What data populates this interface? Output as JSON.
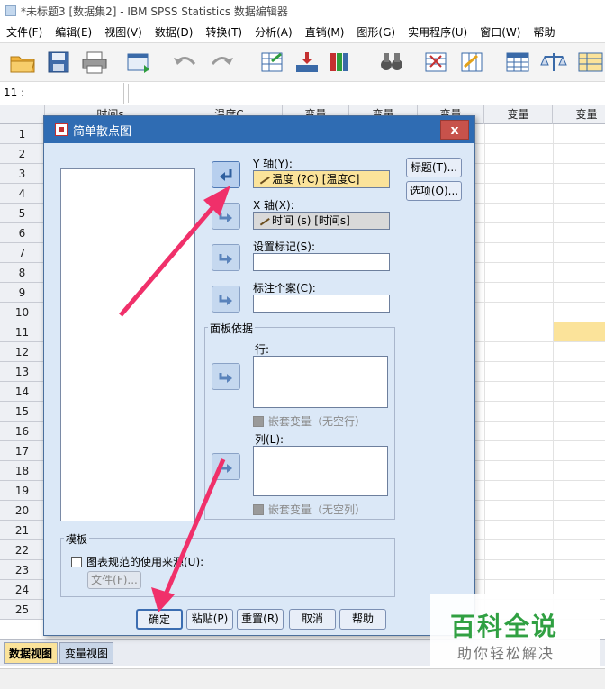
{
  "window": {
    "title": "*未标题3 [数据集2] - IBM SPSS Statistics 数据编辑器"
  },
  "menubar": {
    "items": [
      {
        "label": "文件(F)"
      },
      {
        "label": "编辑(E)"
      },
      {
        "label": "视图(V)"
      },
      {
        "label": "数据(D)"
      },
      {
        "label": "转换(T)"
      },
      {
        "label": "分析(A)"
      },
      {
        "label": "直销(M)"
      },
      {
        "label": "图形(G)"
      },
      {
        "label": "实用程序(U)"
      },
      {
        "label": "窗口(W)"
      },
      {
        "label": "帮助"
      }
    ]
  },
  "toolbar": {
    "icons": [
      "open-folder-icon",
      "save-icon",
      "print-icon",
      "dialog-recall-icon",
      "undo-icon",
      "redo-icon",
      "goto-case-icon",
      "goto-variable-icon",
      "variables-icon",
      "find-icon",
      "insert-cases-icon",
      "insert-variable-icon",
      "split-file-icon",
      "weight-cases-icon",
      "select-cases-icon"
    ],
    "colors": {
      "accent": "#3a6aa8"
    }
  },
  "refbar": {
    "cell_ref": "11 :"
  },
  "grid": {
    "columns": [
      "时间s",
      "温度C",
      "变量",
      "变量",
      "变量",
      "变量",
      "变量"
    ],
    "rows": [
      "1",
      "2",
      "3",
      "4",
      "5",
      "6",
      "7",
      "8",
      "9",
      "10",
      "11",
      "12",
      "13",
      "14",
      "15",
      "16",
      "17",
      "18",
      "19",
      "20",
      "21",
      "22",
      "23",
      "24",
      "25"
    ],
    "highlight_color": "#fbe39a"
  },
  "tabs": {
    "data_view": "数据视图",
    "variable_view": "变量视图"
  },
  "dialog": {
    "title": "简单散点图",
    "close": "x",
    "y_axis": {
      "label": "Y 轴(Y):",
      "value": "温度 (?C) [温度C]"
    },
    "x_axis": {
      "label": "X 轴(X):",
      "value": "时间 (s) [时间s]"
    },
    "set_markers": {
      "label": "设置标记(S):",
      "value": ""
    },
    "label_cases": {
      "label": "标注个案(C):",
      "value": ""
    },
    "panel_by": {
      "title": "面板依据",
      "rows_label": "行:",
      "nest_rows": "嵌套变量（无空行）",
      "cols_label": "列(L):",
      "nest_cols": "嵌套变量（无空列）"
    },
    "template": {
      "title": "模板",
      "use_spec": "图表规范的使用来源(U):",
      "file_button": "文件(F)..."
    },
    "side_buttons": {
      "titles": "标题(T)...",
      "options": "选项(O)..."
    },
    "buttons": {
      "ok": "确定",
      "paste": "粘贴(P)",
      "reset": "重置(R)",
      "cancel": "取消",
      "help": "帮助"
    }
  },
  "watermark": {
    "title": "百科全说",
    "subtitle": "助你轻松解决"
  },
  "annotation": {
    "arrow_color": "#f0306a"
  }
}
